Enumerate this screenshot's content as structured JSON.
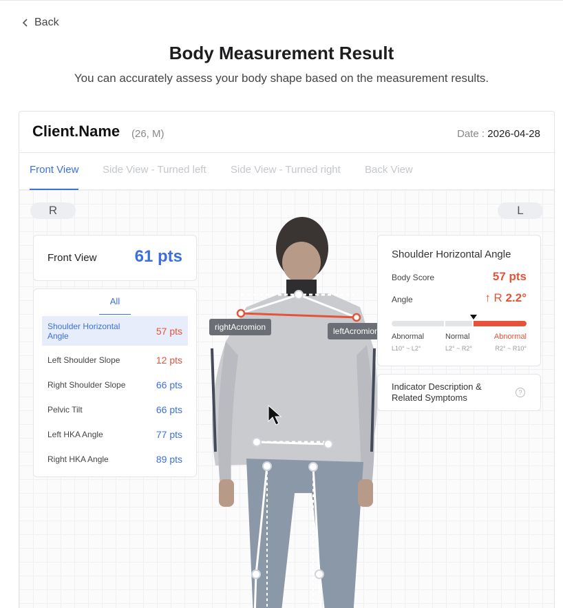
{
  "nav": {
    "back_label": "Back"
  },
  "header": {
    "title": "Body Measurement Result",
    "subtitle": "You can accurately assess your body shape based on the measurement results."
  },
  "client": {
    "name": "Client.Name",
    "meta": "(26, M)",
    "date_label": "Date :",
    "date_value": "2026-04-28"
  },
  "tabs": [
    {
      "label": "Front View",
      "active": true
    },
    {
      "label": "Side View - Turned left",
      "active": false
    },
    {
      "label": "Side View - Turned right",
      "active": false
    },
    {
      "label": "Back View",
      "active": false
    }
  ],
  "orientation": {
    "right": "R",
    "left": "L"
  },
  "summary": {
    "label": "Front View",
    "score": "61 pts"
  },
  "indicators": {
    "filter_label": "All",
    "items": [
      {
        "label": "Shoulder Horizontal Angle",
        "pts": "57 pts",
        "status": "red",
        "selected": true
      },
      {
        "label": "Left Shoulder Slope",
        "pts": "12 pts",
        "status": "red",
        "selected": false
      },
      {
        "label": "Right Shoulder Slope",
        "pts": "66 pts",
        "status": "blue",
        "selected": false
      },
      {
        "label": "Pelvic Tilt",
        "pts": "66 pts",
        "status": "blue",
        "selected": false
      },
      {
        "label": "Left HKA Angle",
        "pts": "77 pts",
        "status": "blue",
        "selected": false
      },
      {
        "label": "Right HKA Angle",
        "pts": "89 pts",
        "status": "blue",
        "selected": false
      }
    ]
  },
  "detail": {
    "title": "Shoulder Horizontal Angle",
    "body_score_label": "Body Score",
    "body_score_value": "57 pts",
    "angle_label": "Angle",
    "angle_arrow": "↑",
    "angle_side": "R",
    "angle_value": "2.2°",
    "scale": [
      {
        "label": "Abnormal",
        "range": "L10° ~ L2°"
      },
      {
        "label": "Normal",
        "range": "L2° ~ R2°"
      },
      {
        "label": "Abnormal",
        "range": "R2° ~ R10°"
      }
    ]
  },
  "description_link": "Indicator Description & Related Symptoms",
  "landmarks": {
    "right": "rightAcromion",
    "left": "leftAcromion"
  },
  "colors": {
    "accent": "#3b6fe0",
    "alert": "#e5533a",
    "selected_bg": "#e8edfb",
    "bar_normal": "#e3e4e6"
  },
  "icons": {
    "back": "chevron-left-icon",
    "help": "question-circle-icon",
    "cursor": "mouse-pointer-icon"
  }
}
